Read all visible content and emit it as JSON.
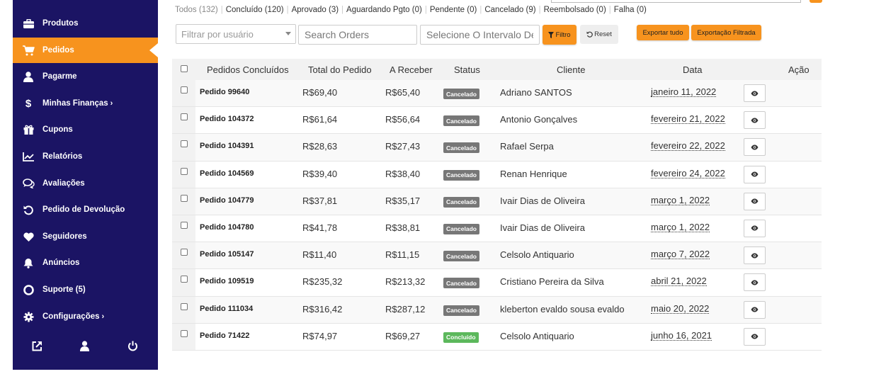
{
  "sidebar": {
    "items": [
      {
        "label": "Produtos",
        "icon": "briefcase-icon",
        "chevron": ""
      },
      {
        "label": "Pedidos",
        "icon": "cart-icon",
        "chevron": "",
        "active": true
      },
      {
        "label": "Pagarme",
        "icon": "user-icon",
        "chevron": ""
      },
      {
        "label": "Minhas Finanças",
        "icon": "dollar-icon",
        "chevron": "›"
      },
      {
        "label": "Cupons",
        "icon": "gift-icon",
        "chevron": ""
      },
      {
        "label": "Relatórios",
        "icon": "chart-icon",
        "chevron": ""
      },
      {
        "label": "Avaliações",
        "icon": "comments-icon",
        "chevron": ""
      },
      {
        "label": "Pedido de Devolução",
        "icon": "undo-icon",
        "chevron": ""
      },
      {
        "label": "Seguidores",
        "icon": "heart-icon",
        "chevron": ""
      },
      {
        "label": "Anúncios",
        "icon": "bell-icon",
        "chevron": ""
      },
      {
        "label": "Suporte (5)",
        "icon": "lifering-icon",
        "chevron": ""
      },
      {
        "label": "Configurações",
        "icon": "gear-icon",
        "chevron": "›"
      }
    ],
    "bottom_icons": [
      "external-link-icon",
      "user-icon",
      "power-icon"
    ]
  },
  "filters": [
    "Todos (132)",
    "Concluído (120)",
    "Aprovado (3)",
    "Aguardando Pgto (0)",
    "Pendente (0)",
    "Cancelado (9)",
    "Reembolsado (0)",
    "Falha (0)"
  ],
  "controls": {
    "user_filter_placeholder": "Filtrar por usuário",
    "search_placeholder": "Search Orders",
    "date_range_placeholder": "Selecione O Intervalo De D",
    "filter_label": "Filtro",
    "reset_label": "Reset",
    "export_all_label": "Exportar tudo",
    "export_filtered_label": "Exportação Filtrada"
  },
  "table": {
    "headers": {
      "order": "Pedidos Concluídos",
      "total": "Total do Pedido",
      "receive": "A Receber",
      "status": "Status",
      "client": "Cliente",
      "date": "Data",
      "action": "Ação"
    },
    "rows": [
      {
        "order": "Pedido 99640",
        "total": "R$69,40",
        "receive": "R$65,40",
        "status": "Cancelado",
        "client": "Adriano SANTOS",
        "date": "janeiro 11, 2022"
      },
      {
        "order": "Pedido 104372",
        "total": "R$61,64",
        "receive": "R$56,64",
        "status": "Cancelado",
        "client": "Antonio Gonçalves",
        "date": "fevereiro 21, 2022"
      },
      {
        "order": "Pedido 104391",
        "total": "R$28,63",
        "receive": "R$27,43",
        "status": "Cancelado",
        "client": "Rafael Serpa",
        "date": "fevereiro 22, 2022"
      },
      {
        "order": "Pedido 104569",
        "total": "R$39,40",
        "receive": "R$38,40",
        "status": "Cancelado",
        "client": "Renan Henrique",
        "date": "fevereiro 24, 2022"
      },
      {
        "order": "Pedido 104779",
        "total": "R$37,81",
        "receive": "R$35,17",
        "status": "Cancelado",
        "client": "Ivair Dias de Oliveira",
        "date": "março 1, 2022"
      },
      {
        "order": "Pedido 104780",
        "total": "R$41,78",
        "receive": "R$38,81",
        "status": "Cancelado",
        "client": "Ivair Dias de Oliveira",
        "date": "março 1, 2022"
      },
      {
        "order": "Pedido 105147",
        "total": "R$11,40",
        "receive": "R$11,15",
        "status": "Cancelado",
        "client": "Celsolo Antiquario",
        "date": "março 7, 2022"
      },
      {
        "order": "Pedido 109519",
        "total": "R$235,32",
        "receive": "R$213,32",
        "status": "Cancelado",
        "client": "Cristiano Pereira da Silva",
        "date": "abril 21, 2022"
      },
      {
        "order": "Pedido 111034",
        "total": "R$316,42",
        "receive": "R$287,12",
        "status": "Cancelado",
        "client": "kleberton evaldo sousa evaldo",
        "date": "maio 20, 2022"
      },
      {
        "order": "Pedido 71422",
        "total": "R$74,97",
        "receive": "R$69,27",
        "status": "Concluído",
        "client": "Celsolo Antiquario",
        "date": "junho 16, 2021"
      }
    ]
  },
  "colors": {
    "sidebar_bg": "#1b1464",
    "accent": "#f7931e",
    "badge_cancelled": "#777777",
    "badge_completed": "#5cb85c"
  }
}
